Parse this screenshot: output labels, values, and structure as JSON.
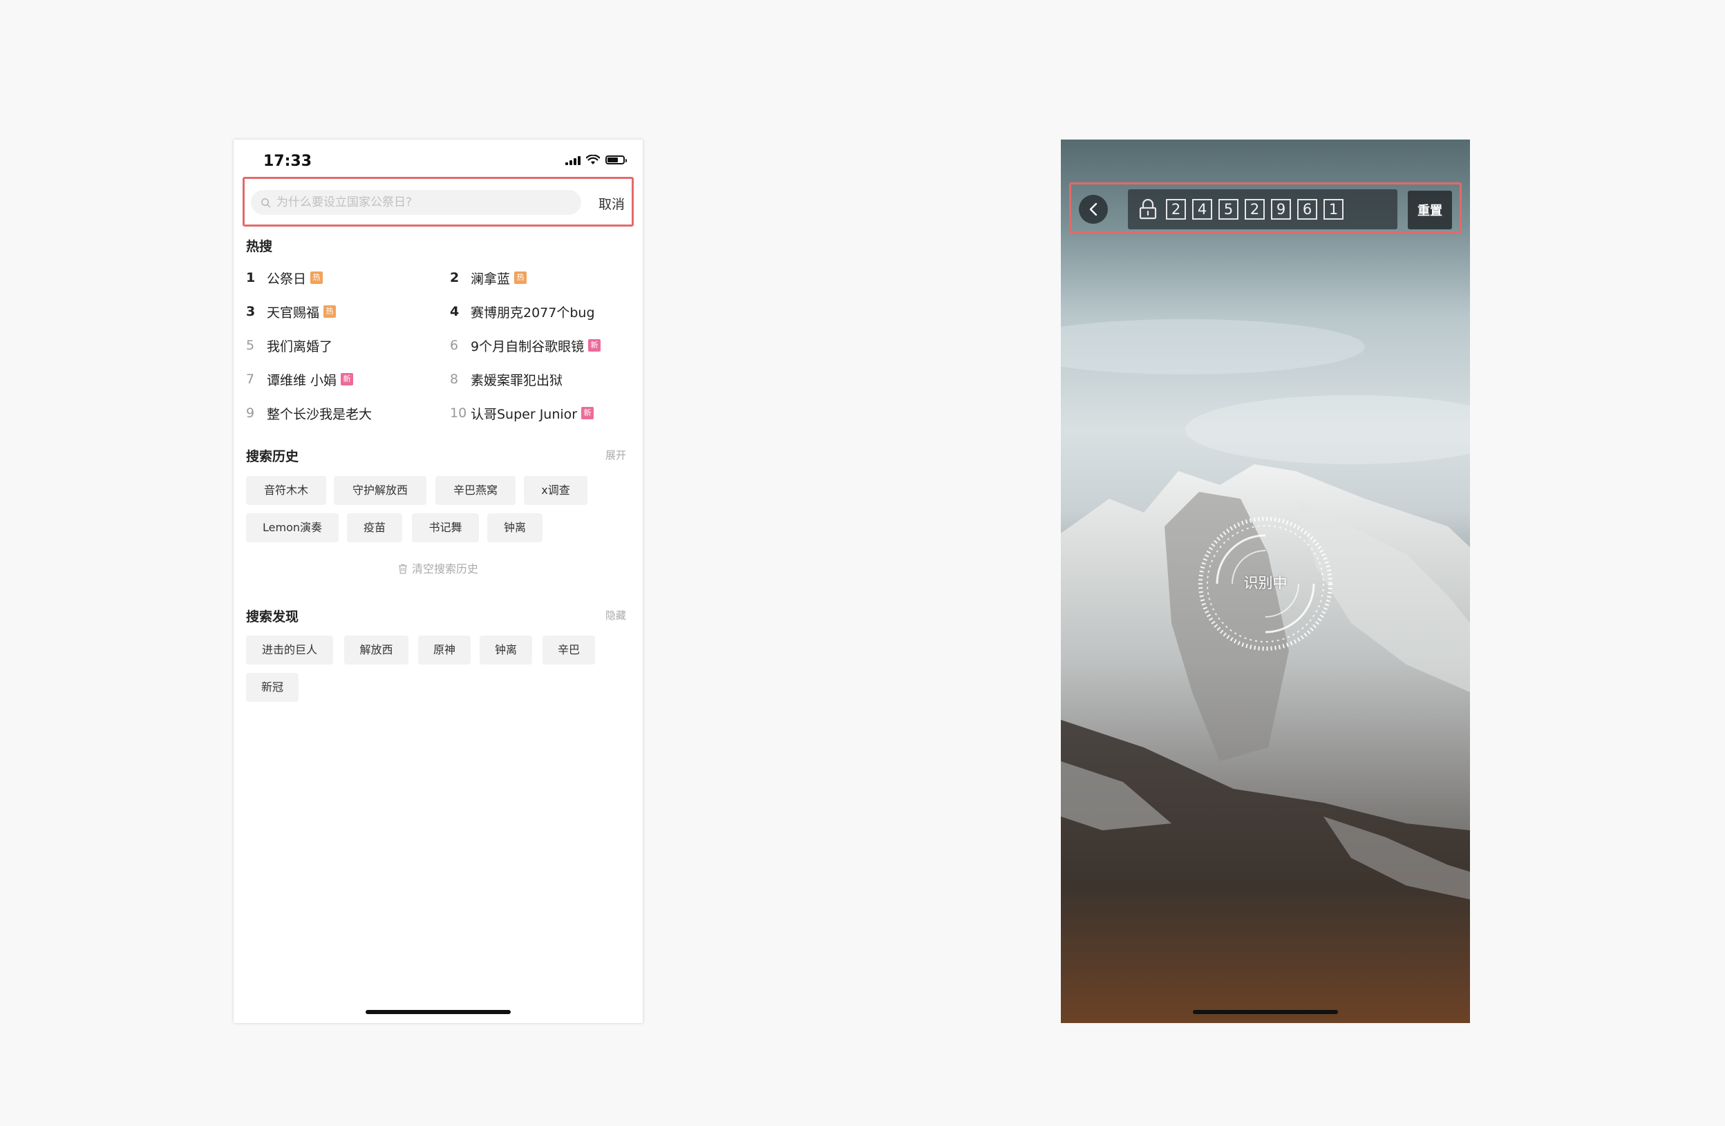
{
  "search_page": {
    "status": {
      "time": "17:33"
    },
    "search": {
      "placeholder": "为什么要设立国家公祭日?",
      "cancel_label": "取消"
    },
    "hot": {
      "title": "热搜",
      "items": [
        {
          "rank": "1",
          "text": "公祭日",
          "badge": "hot",
          "badge_label": "热"
        },
        {
          "rank": "2",
          "text": "澜拿蓝",
          "badge": "hot",
          "badge_label": "热"
        },
        {
          "rank": "3",
          "text": "天官赐福",
          "badge": "hot",
          "badge_label": "热"
        },
        {
          "rank": "4",
          "text": "赛博朋克2077个bug",
          "badge": "",
          "badge_label": ""
        },
        {
          "rank": "5",
          "text": "我们离婚了",
          "badge": "",
          "badge_label": ""
        },
        {
          "rank": "6",
          "text": "9个月自制谷歌眼镜",
          "badge": "new",
          "badge_label": "新"
        },
        {
          "rank": "7",
          "text": "谭维维 小娟",
          "badge": "new",
          "badge_label": "新"
        },
        {
          "rank": "8",
          "text": "素媛案罪犯出狱",
          "badge": "",
          "badge_label": ""
        },
        {
          "rank": "9",
          "text": "整个长沙我是老大",
          "badge": "",
          "badge_label": ""
        },
        {
          "rank": "10",
          "text": "认哥Super Junior",
          "badge": "new",
          "badge_label": "新"
        }
      ]
    },
    "history": {
      "title": "搜索历史",
      "action": "展开",
      "chips": [
        "音符木木",
        "守护解放西",
        "辛巴燕窝",
        "x调查",
        "Lemon演奏",
        "疫苗",
        "书记舞",
        "钟离"
      ],
      "clear_label": "清空搜索历史"
    },
    "discover": {
      "title": "搜索发现",
      "action": "隐藏",
      "chips": [
        "进击的巨人",
        "解放西",
        "原神",
        "钟离",
        "辛巴",
        "新冠"
      ]
    }
  },
  "recognition_page": {
    "code_digits": [
      "2",
      "4",
      "5",
      "2",
      "9",
      "6",
      "1"
    ],
    "reset_label": "重置",
    "scan_status": "识别中"
  },
  "colors": {
    "highlight_border": "#e36a6a",
    "hot_badge": "#f0a35c",
    "new_badge": "#ec6b9a"
  },
  "icons": [
    "search-icon",
    "trash-icon",
    "chevron-left-icon",
    "lock-icon",
    "wifi-icon",
    "battery-icon",
    "signal-icon"
  ]
}
